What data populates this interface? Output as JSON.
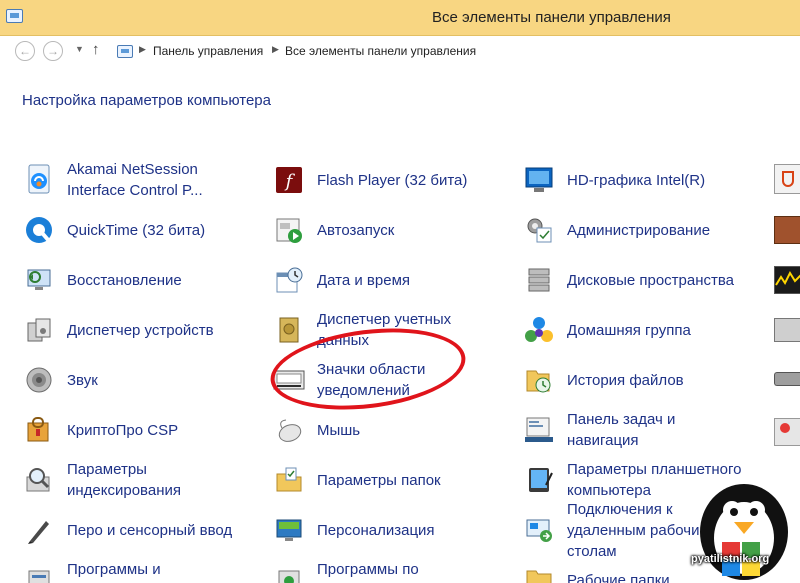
{
  "window": {
    "title": "Все элементы панели управления"
  },
  "address": {
    "path": [
      "Панель управления",
      "Все элементы панели управления"
    ]
  },
  "main": {
    "heading": "Настройка параметров компьютера"
  },
  "items": {
    "akamai": "Akamai NetSession Interface Control P...",
    "flash": "Flash Player (32 бита)",
    "hd_graphics": "HD-графика Intel(R)",
    "quicktime": "QuickTime (32 бита)",
    "autorun": "Автозапуск",
    "admin": "Администрирование",
    "recovery": "Восстановление",
    "datetime": "Дата и время",
    "storage_spaces": "Дисковые пространства",
    "device_manager": "Диспетчер устройств",
    "credential_manager": "Диспетчер учетных данных",
    "homegroup": "Домашняя группа",
    "sound": "Звук",
    "notification_icons": "Значки области уведомлений",
    "file_history": "История файлов",
    "cryptopro": "КриптоПро CSP",
    "mouse": "Мышь",
    "taskbar": "Панель задач и навигация",
    "indexing": "Параметры индексирования",
    "folder_options": "Параметры папок",
    "tablet": "Параметры планшетного компьютера",
    "pen_touch": "Перо и сенсорный ввод",
    "personalization": "Персонализация",
    "remote_apps": "Подключения к удаленным рабочим столам",
    "programs": "Программы и компоненты",
    "default_programs": "Программы по умолчанию",
    "work_folders": "Рабочие папки"
  },
  "watermark": {
    "text": "pyatilistnik.org"
  }
}
